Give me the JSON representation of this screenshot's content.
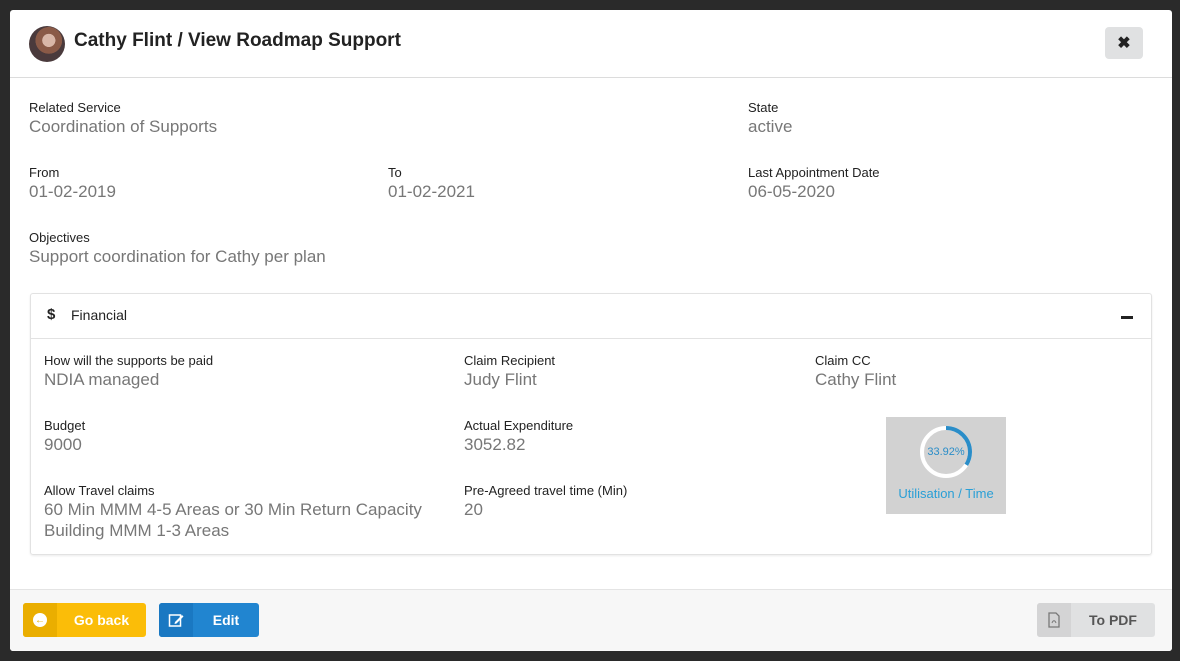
{
  "header": {
    "title": "Cathy Flint / View Roadmap Support",
    "close_symbol": "✖"
  },
  "details": {
    "related_service": {
      "label": "Related Service",
      "value": "Coordination of Supports"
    },
    "state": {
      "label": "State",
      "value": "active"
    },
    "from": {
      "label": "From",
      "value": "01-02-2019"
    },
    "to": {
      "label": "To",
      "value": "01-02-2021"
    },
    "last_appointment": {
      "label": "Last Appointment Date",
      "value": "06-05-2020"
    },
    "objectives": {
      "label": "Objectives",
      "value": "Support coordination for Cathy per plan"
    }
  },
  "financial": {
    "title": "Financial",
    "icon_symbol": "$",
    "payment": {
      "label": "How will the supports be paid",
      "value": "NDIA managed"
    },
    "claim_recipient": {
      "label": "Claim Recipient",
      "value": "Judy Flint"
    },
    "claim_cc": {
      "label": "Claim CC",
      "value": "Cathy Flint"
    },
    "budget": {
      "label": "Budget",
      "value": "9000"
    },
    "actual_expenditure": {
      "label": "Actual Expenditure",
      "value": "3052.82"
    },
    "travel_claims": {
      "label": "Allow Travel claims",
      "value_line1": "60 Min MMM 4-5 Areas or 30 Min Return Capacity",
      "value_line2": "Building MMM 1-3 Areas"
    },
    "travel_time": {
      "label": "Pre-Agreed travel time (Min)",
      "value": "20"
    },
    "utilisation": {
      "percent_text": "33.92%",
      "percent": 33.92,
      "caption": "Utilisation / Time"
    }
  },
  "footer": {
    "back_label": "Go back",
    "edit_label": "Edit",
    "pdf_label": "To PDF"
  },
  "colors": {
    "back": "#fbbd08",
    "edit": "#2185d0",
    "gauge": "#2a9fd6"
  },
  "icons": {
    "avatar": "user-avatar",
    "close": "close-icon",
    "dollar": "dollar-icon",
    "collapse": "minus-icon",
    "back": "arrow-left-icon",
    "edit": "edit-icon",
    "pdf": "pdf-file-icon"
  }
}
